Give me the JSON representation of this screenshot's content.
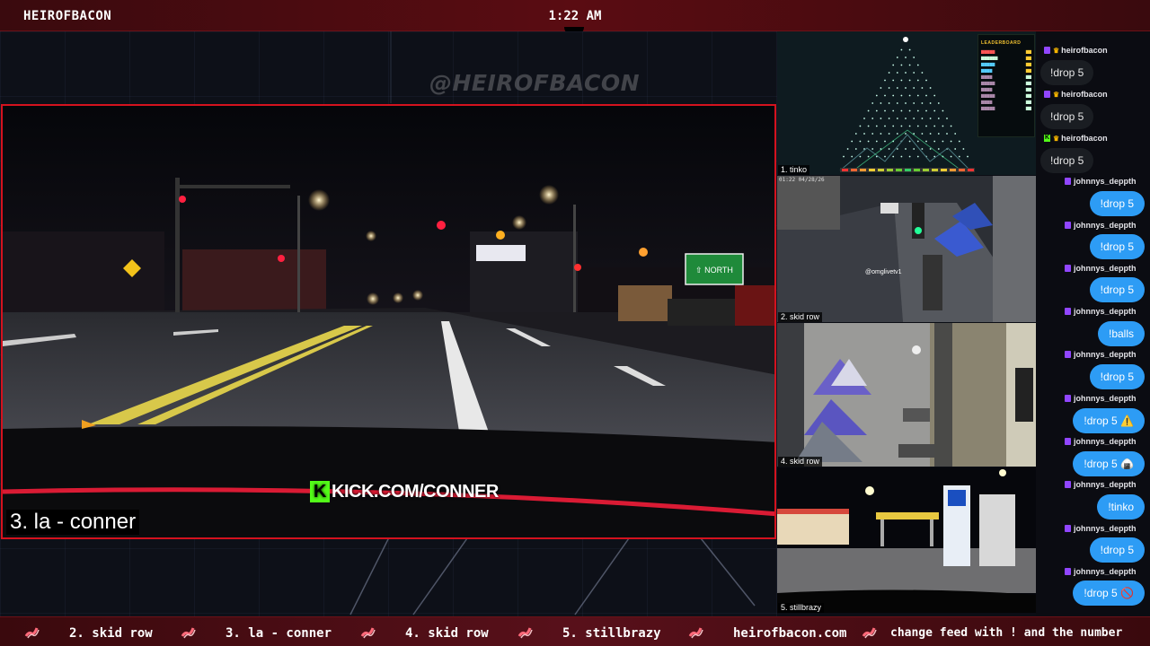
{
  "topbar": {
    "channel": "HEIROFBACON",
    "time": "1:22 AM"
  },
  "watermark": "@HEIROFBACON",
  "main_feed": {
    "label": "3. la - conner",
    "overlay_text": "KICK.COM/CONNER",
    "overlay_k": "K"
  },
  "side_feeds": [
    {
      "label": "1. tinko"
    },
    {
      "label": "2. skid row",
      "timestamp": "01:22 04/28/26",
      "overlay": "@omglivetv1"
    },
    {
      "label": "4. skid row"
    },
    {
      "label": "5. stillbrazy"
    }
  ],
  "leaderboard": {
    "title": "LEADERBOARD"
  },
  "chat": [
    {
      "user": "heirofbacon",
      "platform": "twitch",
      "crown": true,
      "message": "!drop 5",
      "side": "left"
    },
    {
      "user": "heirofbacon",
      "platform": "twitch",
      "crown": true,
      "message": "!drop 5",
      "side": "left"
    },
    {
      "user": "heirofbacon",
      "platform": "kick",
      "crown": true,
      "message": "!drop 5",
      "side": "left"
    },
    {
      "user": "johnnys_deppth",
      "platform": "twitch",
      "message": "!drop 5",
      "side": "right"
    },
    {
      "user": "johnnys_deppth",
      "platform": "twitch",
      "message": "!drop 5",
      "side": "right"
    },
    {
      "user": "johnnys_deppth",
      "platform": "twitch",
      "message": "!drop 5",
      "side": "right"
    },
    {
      "user": "johnnys_deppth",
      "platform": "twitch",
      "message": "!balls",
      "side": "right"
    },
    {
      "user": "johnnys_deppth",
      "platform": "twitch",
      "message": "!drop 5",
      "side": "right"
    },
    {
      "user": "johnnys_deppth",
      "platform": "twitch",
      "message": "!drop 5 ⚠️",
      "side": "right"
    },
    {
      "user": "johnnys_deppth",
      "platform": "twitch",
      "message": "!drop 5 🍙",
      "side": "right"
    },
    {
      "user": "johnnys_deppth",
      "platform": "twitch",
      "message": "!tinko",
      "side": "right"
    },
    {
      "user": "johnnys_deppth",
      "platform": "twitch",
      "message": "!drop 5",
      "side": "right"
    },
    {
      "user": "johnnys_deppth",
      "platform": "twitch",
      "message": "!drop 5 🚫",
      "side": "right"
    }
  ],
  "ticker": {
    "items": [
      "2. skid row",
      "3. la - conner",
      "4. skid row",
      "5. stillbrazy",
      "heirofbacon.com",
      "change feed with ! and the number"
    ],
    "icon": "bacon-icon"
  },
  "colors": {
    "accent_red": "#d4121e",
    "chat_blue": "#2d9cf5",
    "kick_green": "#53fc18",
    "twitch_purple": "#9146ff"
  }
}
